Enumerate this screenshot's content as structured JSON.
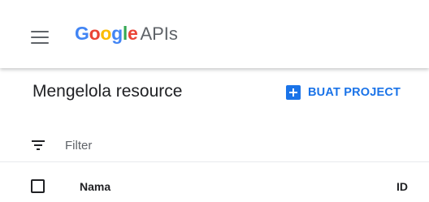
{
  "header": {
    "menu_icon": "hamburger-menu-icon",
    "logo": {
      "google_letters": [
        "G",
        "o",
        "o",
        "g",
        "l",
        "e"
      ],
      "product": "APIs"
    }
  },
  "main": {
    "page_title": "Mengelola resource",
    "create_button": {
      "icon": "add-box-icon",
      "label": "BUAT PROJECT"
    }
  },
  "filter": {
    "icon": "filter-list-icon",
    "placeholder": "Filter",
    "value": ""
  },
  "table": {
    "columns": [
      "Nama",
      "ID"
    ]
  },
  "colors": {
    "accent": "#1a73e8",
    "google_blue": "#4285F4",
    "google_red": "#EA4335",
    "google_yellow": "#FBBC05",
    "google_green": "#34A853",
    "text_primary": "#202124",
    "text_secondary": "#5f6368"
  }
}
